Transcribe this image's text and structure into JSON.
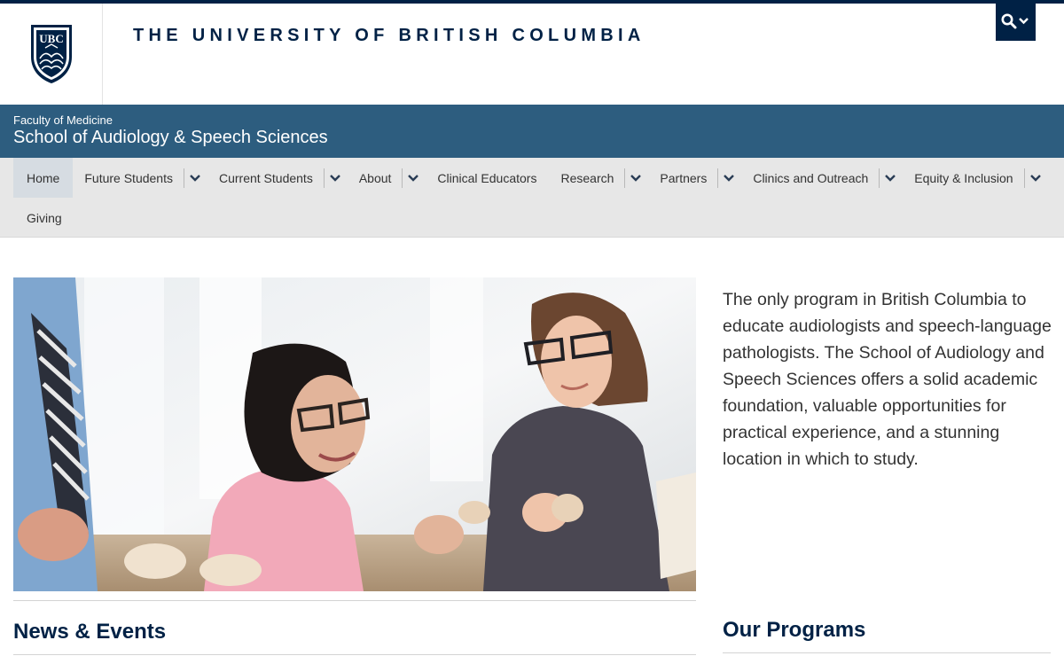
{
  "header": {
    "logo_text": "UBC",
    "university_name": "THE UNIVERSITY OF BRITISH COLUMBIA",
    "brand_color": "#002145"
  },
  "unit": {
    "faculty": "Faculty of Medicine",
    "school": "School of Audiology & Speech Sciences",
    "bar_color": "#2d5d7f"
  },
  "nav": {
    "items": [
      {
        "label": "Home",
        "active": true,
        "dropdown": false
      },
      {
        "label": "Future Students",
        "dropdown": true
      },
      {
        "label": "Current Students",
        "dropdown": true
      },
      {
        "label": "About",
        "dropdown": true
      },
      {
        "label": "Clinical Educators",
        "dropdown": false
      },
      {
        "label": "Research",
        "dropdown": true
      },
      {
        "label": "Partners",
        "dropdown": true
      },
      {
        "label": "Clinics and Outreach",
        "dropdown": true
      },
      {
        "label": "Equity & Inclusion",
        "dropdown": true
      },
      {
        "label": "Giving",
        "dropdown": false
      }
    ]
  },
  "main": {
    "intro": "The only program in British Columbia to educate audiologists and speech-language pathologists. The School of Audiology and Speech Sciences offers a solid academic foundation, valuable opportunities for practical experience, and a stunning location in which to study.",
    "news_heading": "News & Events",
    "programs_heading": "Our Programs"
  }
}
